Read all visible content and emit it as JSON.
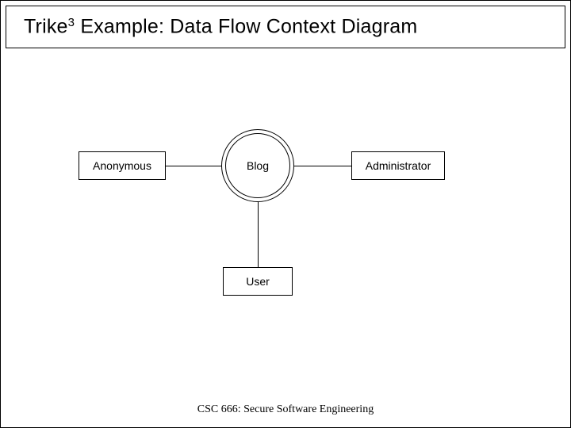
{
  "title": {
    "prefix": "Trike",
    "superscript": "3",
    "rest": " Example: Data Flow Context Diagram"
  },
  "entities": {
    "anonymous": "Anonymous",
    "administrator": "Administrator",
    "user": "User"
  },
  "process": {
    "blog": "Blog"
  },
  "connectors": [
    {
      "from": "anonymous",
      "to": "blog"
    },
    {
      "from": "blog",
      "to": "administrator"
    },
    {
      "from": "blog",
      "to": "user"
    }
  ],
  "footer": "CSC 666: Secure Software Engineering"
}
